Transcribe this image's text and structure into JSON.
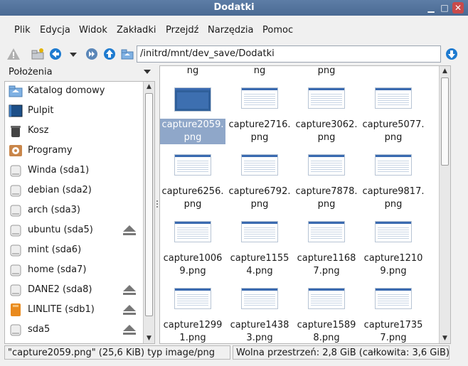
{
  "window": {
    "title": "Dodatki"
  },
  "menu": [
    "Plik",
    "Edycja",
    "Widok",
    "Zakładki",
    "Przejdź",
    "Narzędzia",
    "Pomoc"
  ],
  "toolbar": {
    "path": "/initrd/mnt/dev_save/Dodatki"
  },
  "sidebar": {
    "header": "Położenia",
    "items": [
      {
        "label": "Katalog domowy",
        "icon": "home-folder-icon",
        "eject": false
      },
      {
        "label": "Pulpit",
        "icon": "desktop-icon",
        "eject": false
      },
      {
        "label": "Kosz",
        "icon": "trash-icon",
        "eject": false
      },
      {
        "label": "Programy",
        "icon": "applications-icon",
        "eject": false
      },
      {
        "label": "Winda (sda1)",
        "icon": "drive-icon",
        "eject": false
      },
      {
        "label": "debian (sda2)",
        "icon": "drive-icon",
        "eject": false
      },
      {
        "label": "arch (sda3)",
        "icon": "drive-icon",
        "eject": false
      },
      {
        "label": "ubuntu (sda5)",
        "icon": "drive-icon",
        "eject": true
      },
      {
        "label": "mint (sda6)",
        "icon": "drive-icon",
        "eject": false
      },
      {
        "label": "home (sda7)",
        "icon": "drive-icon",
        "eject": false
      },
      {
        "label": "DANE2 (sda8)",
        "icon": "drive-icon",
        "eject": true
      },
      {
        "label": "LINLITE (sdb1)",
        "icon": "usb-drive-icon",
        "eject": true
      },
      {
        "label": "sda5",
        "icon": "drive-icon",
        "eject": true
      }
    ]
  },
  "files": {
    "partial_row": [
      "ng",
      "ng",
      "png"
    ],
    "items": [
      {
        "line1": "capture2059.",
        "line2": "png",
        "selected": true
      },
      {
        "line1": "capture2716.",
        "line2": "png",
        "selected": false
      },
      {
        "line1": "capture3062.",
        "line2": "png",
        "selected": false
      },
      {
        "line1": "capture5077.",
        "line2": "png",
        "selected": false
      },
      {
        "line1": "capture6256.",
        "line2": "png",
        "selected": false
      },
      {
        "line1": "capture6792.",
        "line2": "png",
        "selected": false
      },
      {
        "line1": "capture7878.",
        "line2": "png",
        "selected": false
      },
      {
        "line1": "capture9817.",
        "line2": "png",
        "selected": false
      },
      {
        "line1": "capture1006",
        "line2": "9.png",
        "selected": false
      },
      {
        "line1": "capture1155",
        "line2": "4.png",
        "selected": false
      },
      {
        "line1": "capture1168",
        "line2": "7.png",
        "selected": false
      },
      {
        "line1": "capture1210",
        "line2": "9.png",
        "selected": false
      },
      {
        "line1": "capture1299",
        "line2": "1.png",
        "selected": false
      },
      {
        "line1": "capture1438",
        "line2": "3.png",
        "selected": false
      },
      {
        "line1": "capture1589",
        "line2": "8.png",
        "selected": false
      },
      {
        "line1": "capture1735",
        "line2": "7.png",
        "selected": false
      }
    ]
  },
  "status": {
    "left": "\"capture2059.png\" (25,6 KiB) typ image/png",
    "right": "Wolna przestrzeń: 2,8 GiB (całkowita: 3,6 GiB)"
  },
  "colors": {
    "titlebar": "#4a6a93",
    "selection": "#8fa7c9",
    "accent": "#1e7bd0"
  }
}
